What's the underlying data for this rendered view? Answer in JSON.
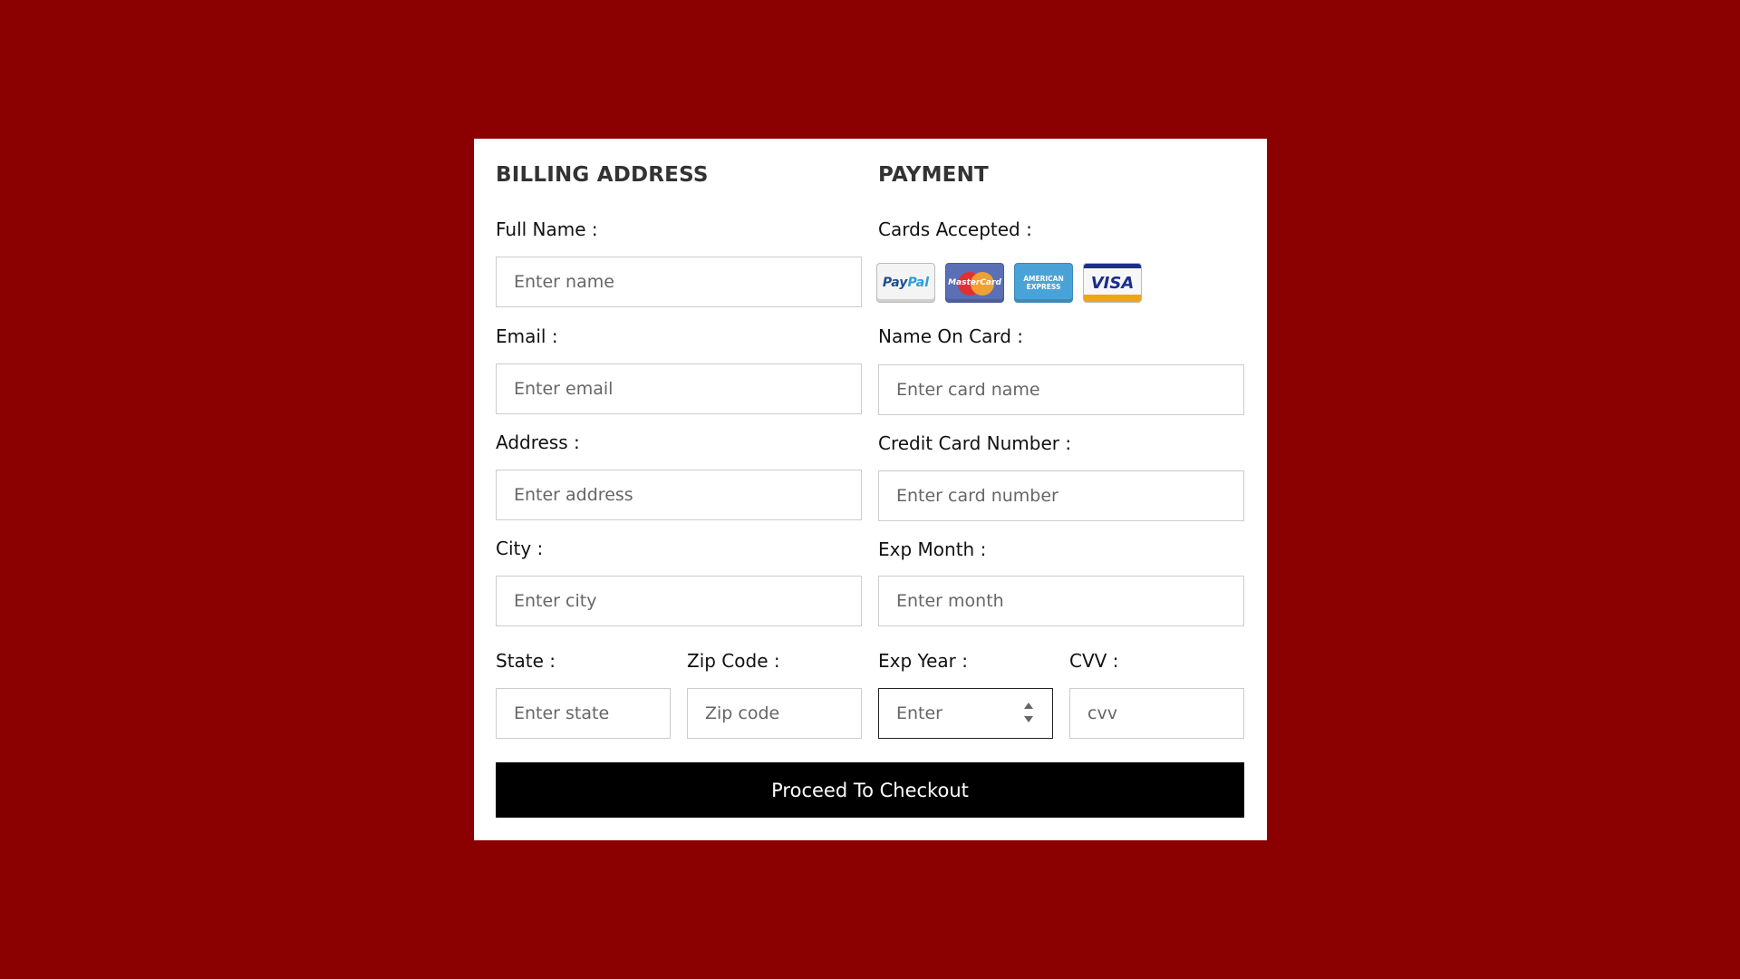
{
  "billing": {
    "title": "BILLING ADDRESS",
    "full_name": {
      "label": "Full Name :",
      "placeholder": "Enter name"
    },
    "email": {
      "label": "Email :",
      "placeholder": "Enter email"
    },
    "address": {
      "label": "Address :",
      "placeholder": "Enter address"
    },
    "city": {
      "label": "City :",
      "placeholder": "Enter city"
    },
    "state": {
      "label": "State :",
      "placeholder": "Enter state"
    },
    "zip": {
      "label": "Zip Code :",
      "placeholder": "Zip code"
    }
  },
  "payment": {
    "title": "PAYMENT",
    "cards_accepted": {
      "label": "Cards Accepted :",
      "cards": [
        {
          "name": "paypal-card-icon",
          "text_a": "Pay",
          "text_b": "Pal"
        },
        {
          "name": "mastercard-card-icon",
          "text": "MasterCard"
        },
        {
          "name": "american-express-card-icon",
          "text_a": "AMERICAN",
          "text_b": "EXPRESS"
        },
        {
          "name": "visa-card-icon",
          "text": "VISA"
        }
      ]
    },
    "name_on_card": {
      "label": "Name On Card :",
      "placeholder": "Enter card name"
    },
    "card_number": {
      "label": "Credit Card Number :",
      "placeholder": "Enter card number"
    },
    "exp_month": {
      "label": "Exp Month :",
      "placeholder": "Enter month"
    },
    "exp_year": {
      "label": "Exp Year :",
      "placeholder": "Enter"
    },
    "cvv": {
      "label": "CVV :",
      "placeholder": "cvv"
    }
  },
  "checkout_button": "Proceed To Checkout",
  "colors": {
    "background": "#8b0000",
    "card": "#ffffff",
    "button": "#000000"
  }
}
